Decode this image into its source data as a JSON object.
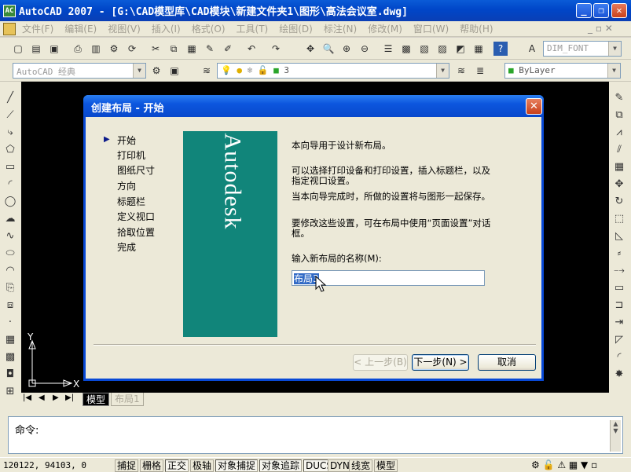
{
  "window": {
    "title": "AutoCAD 2007 - [G:\\CAD模型库\\CAD模块\\新建文件夹1\\图形\\高法会议室.dwg]",
    "app_icon_text": "AC"
  },
  "menu": [
    "文件(F)",
    "编辑(E)",
    "视图(V)",
    "插入(I)",
    "格式(O)",
    "工具(T)",
    "绘图(D)",
    "标注(N)",
    "修改(M)",
    "窗口(W)",
    "帮助(H)"
  ],
  "toolbar": {
    "text_style": "DIM_FONT",
    "workspace": "AutoCAD 经典",
    "layer_value": "3",
    "linetype": "ByLayer"
  },
  "canvas": {
    "ucs_y": "Y",
    "ucs_x": "X"
  },
  "dialog": {
    "title": "创建布局 - 开始",
    "steps": [
      "开始",
      "打印机",
      "图纸尺寸",
      "方向",
      "标题栏",
      "定义视口",
      "拾取位置",
      "完成"
    ],
    "current_step": "开始",
    "banner": "Autodesk",
    "para1": "本向导用于设计新布局。",
    "para2": "可以选择打印设备和打印设置，插入标题栏，以及指定视口设置。",
    "para3": "当本向导完成时，所做的设置将与图形一起保存。",
    "para4": "要修改这些设置，可在布局中使用“页面设置”对话框。",
    "input_label": "输入新布局的名称(M):",
    "input_value": "布局3",
    "back_button": "< 上一步(B)",
    "next_button": "下一步(N) >",
    "cancel_button": "取消"
  },
  "tabs": {
    "model": "模型",
    "layout": "布局1"
  },
  "command": {
    "prompt": "命令:"
  },
  "status": {
    "coords": "120122, 94103, 0",
    "toggles": [
      "捕捉",
      "栅格",
      "正交",
      "极轴",
      "对象捕捉",
      "对象追踪",
      "DUCS",
      "DYN",
      "线宽",
      "模型"
    ]
  }
}
